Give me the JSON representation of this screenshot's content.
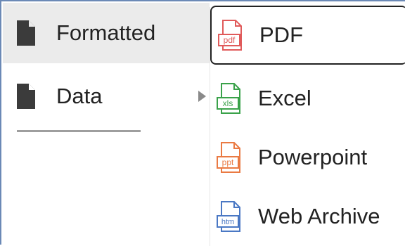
{
  "menu": {
    "items": [
      {
        "label": "Formatted",
        "icon": "document-icon",
        "highlighted": true
      },
      {
        "label": "Data",
        "icon": "document-icon",
        "has_submenu": true
      }
    ]
  },
  "submenu": {
    "items": [
      {
        "label": "PDF",
        "icon": "pdf-file-icon",
        "icon_text": "pdf",
        "color": "#e05a5a",
        "selected": true
      },
      {
        "label": "Excel",
        "icon": "excel-file-icon",
        "icon_text": "xls",
        "color": "#3aa24a"
      },
      {
        "label": "Powerpoint",
        "icon": "powerpoint-file-icon",
        "icon_text": "ppt",
        "color": "#ea7a43"
      },
      {
        "label": "Web Archive",
        "icon": "web-archive-file-icon",
        "icon_text": "htm",
        "color": "#4a78c4"
      }
    ]
  },
  "colors": {
    "frame_border": "#6b89b6",
    "highlight_bg": "#ebebeb",
    "text": "#222222"
  }
}
